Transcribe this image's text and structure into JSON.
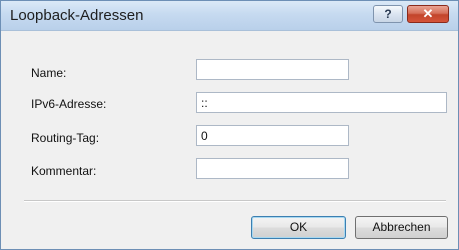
{
  "window": {
    "title": "Loopback-Adressen"
  },
  "titlebar_buttons": {
    "help": "?",
    "close": "✕"
  },
  "form": {
    "name": {
      "label": "Name:",
      "value": ""
    },
    "ipv6": {
      "label": "IPv6-Adresse:",
      "value": "::"
    },
    "routing_tag": {
      "label": "Routing-Tag:",
      "value": "0"
    },
    "comment": {
      "label": "Kommentar:",
      "value": ""
    }
  },
  "buttons": {
    "ok": "OK",
    "cancel": "Abbrechen"
  },
  "colors": {
    "titlebar": "#c6daf0",
    "close_button": "#c2442b",
    "dialog_bg": "#f0f0f0"
  }
}
